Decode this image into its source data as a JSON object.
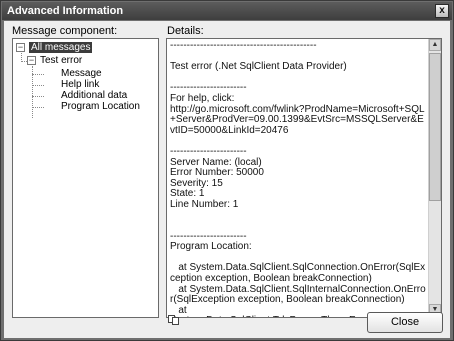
{
  "window": {
    "title": "Advanced Information",
    "close_glyph": "x"
  },
  "labels": {
    "message_component": "Message component:",
    "details": "Details:"
  },
  "tree": {
    "root": {
      "label": "All messages",
      "toggle": "−",
      "selected": true
    },
    "child": {
      "label": "Test error",
      "toggle": "−"
    },
    "leaves": [
      "Message",
      "Help link",
      "Additional data",
      "Program Location"
    ]
  },
  "details_text": "--------------------------------------------\n\nTest error (.Net SqlClient Data Provider)\n\n-----------------------\nFor help, click:\nhttp://go.microsoft.com/fwlink?ProdName=Microsoft+SQL+Server&ProdVer=09.00.1399&EvtSrc=MSSQLServer&EvtID=50000&LinkId=20476\n\n-----------------------\nServer Name: (local)\nError Number: 50000\nSeverity: 15\nState: 1\nLine Number: 1\n\n\n-----------------------\nProgram Location:\n\n   at System.Data.SqlClient.SqlConnection.OnError(SqlException exception, Boolean breakConnection)\n   at System.Data.SqlClient.SqlInternalConnection.OnError(SqlException exception, Boolean breakConnection)\n   at\nSystem.Data.SqlClient.TdsParser.ThrowExceptionAndWarning(TdsParserStateObject stateObj)",
  "buttons": {
    "close": "Close"
  },
  "icons": {
    "copy": "copy-icon",
    "scroll_up": "scroll-up-icon",
    "scroll_down": "scroll-down-icon"
  }
}
